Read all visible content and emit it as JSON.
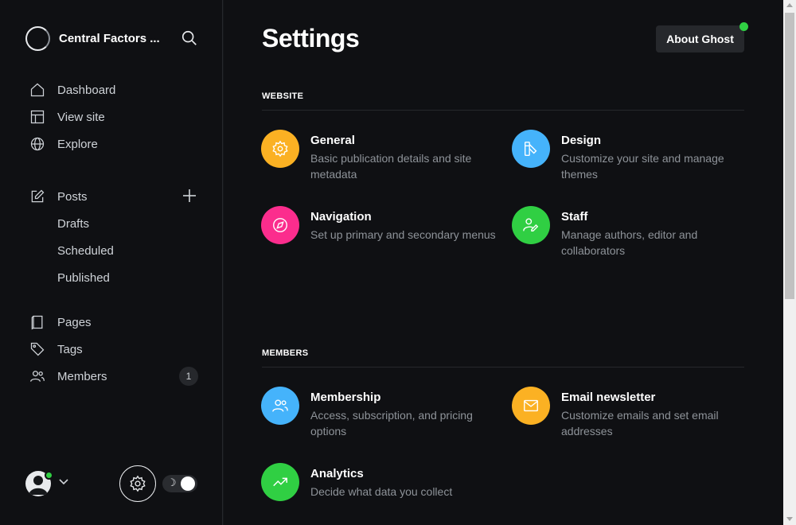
{
  "brand": {
    "name": "Central Factors ..."
  },
  "nav": {
    "primary": [
      {
        "label": "Dashboard",
        "icon": "home-icon"
      },
      {
        "label": "View site",
        "icon": "layout-icon"
      },
      {
        "label": "Explore",
        "icon": "globe-icon"
      }
    ],
    "posts": {
      "label": "Posts",
      "icon": "edit-icon"
    },
    "posts_sub": [
      "Drafts",
      "Scheduled",
      "Published"
    ],
    "secondary": [
      {
        "label": "Pages",
        "icon": "book-icon"
      },
      {
        "label": "Tags",
        "icon": "tag-icon"
      },
      {
        "label": "Members",
        "icon": "members-icon",
        "badge": "1"
      }
    ]
  },
  "footer": {
    "theme_toggle_icon": "☽"
  },
  "main": {
    "title": "Settings",
    "about_button": "About Ghost",
    "sections": [
      {
        "heading": "WEBSITE",
        "cards": [
          {
            "title": "General",
            "desc": "Basic publication details and site metadata",
            "color": "#fbb123",
            "icon": "gear-icon"
          },
          {
            "title": "Design",
            "desc": "Customize your site and manage themes",
            "color": "#45b3fb",
            "icon": "brush-icon"
          },
          {
            "title": "Navigation",
            "desc": "Set up primary and secondary menus",
            "color": "#fb2d8d",
            "icon": "compass-icon"
          },
          {
            "title": "Staff",
            "desc": "Manage authors, editor and collaborators",
            "color": "#30cf43",
            "icon": "staff-icon"
          }
        ]
      },
      {
        "heading": "MEMBERS",
        "cards": [
          {
            "title": "Membership",
            "desc": "Access, subscription, and pricing options",
            "color": "#45b3fb",
            "icon": "members-icon"
          },
          {
            "title": "Email newsletter",
            "desc": "Customize emails and set email addresses",
            "color": "#fbb123",
            "icon": "mail-icon"
          },
          {
            "title": "Analytics",
            "desc": "Decide what data you collect",
            "color": "#30cf43",
            "icon": "trending-icon"
          }
        ]
      }
    ]
  },
  "colors": {
    "accent_green": "#30cf43",
    "sidebar_bg": "#0f1013"
  }
}
